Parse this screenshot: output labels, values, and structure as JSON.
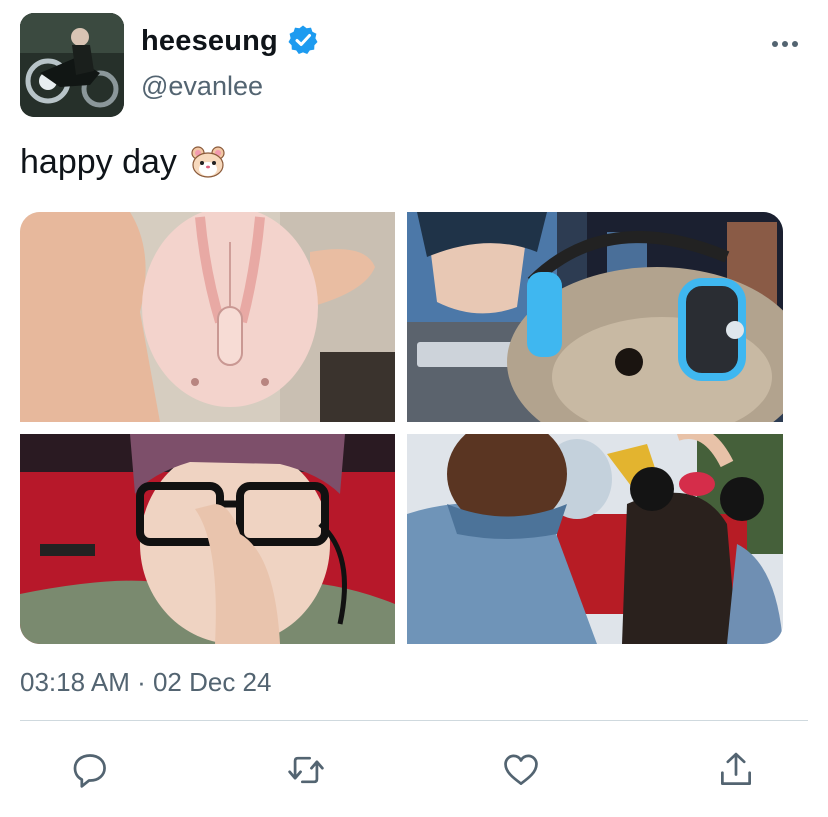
{
  "author": {
    "display_name": "heeseung",
    "handle": "@evanlee",
    "verified_icon": "verified-badge-icon",
    "avatar": "motorcycle-rider-avatar"
  },
  "tweet": {
    "text": "happy day",
    "emoji": "hamster-face-emoji",
    "timestamp": "03:18 AM · 02 Dec 24"
  },
  "media": [
    {
      "subject": "pink-mouse-photo"
    },
    {
      "subject": "hamster-headphones-photo"
    },
    {
      "subject": "selfie-glasses-photo"
    },
    {
      "subject": "couple-amusement-park-photo"
    }
  ],
  "actions": {
    "reply_icon": "reply-icon",
    "retweet_icon": "retweet-icon",
    "like_icon": "like-icon",
    "share_icon": "share-icon"
  },
  "colors": {
    "accent": "#1d9bf0",
    "secondary_text": "#536471",
    "primary_text": "#0f1419",
    "divider": "#cfd9de"
  }
}
